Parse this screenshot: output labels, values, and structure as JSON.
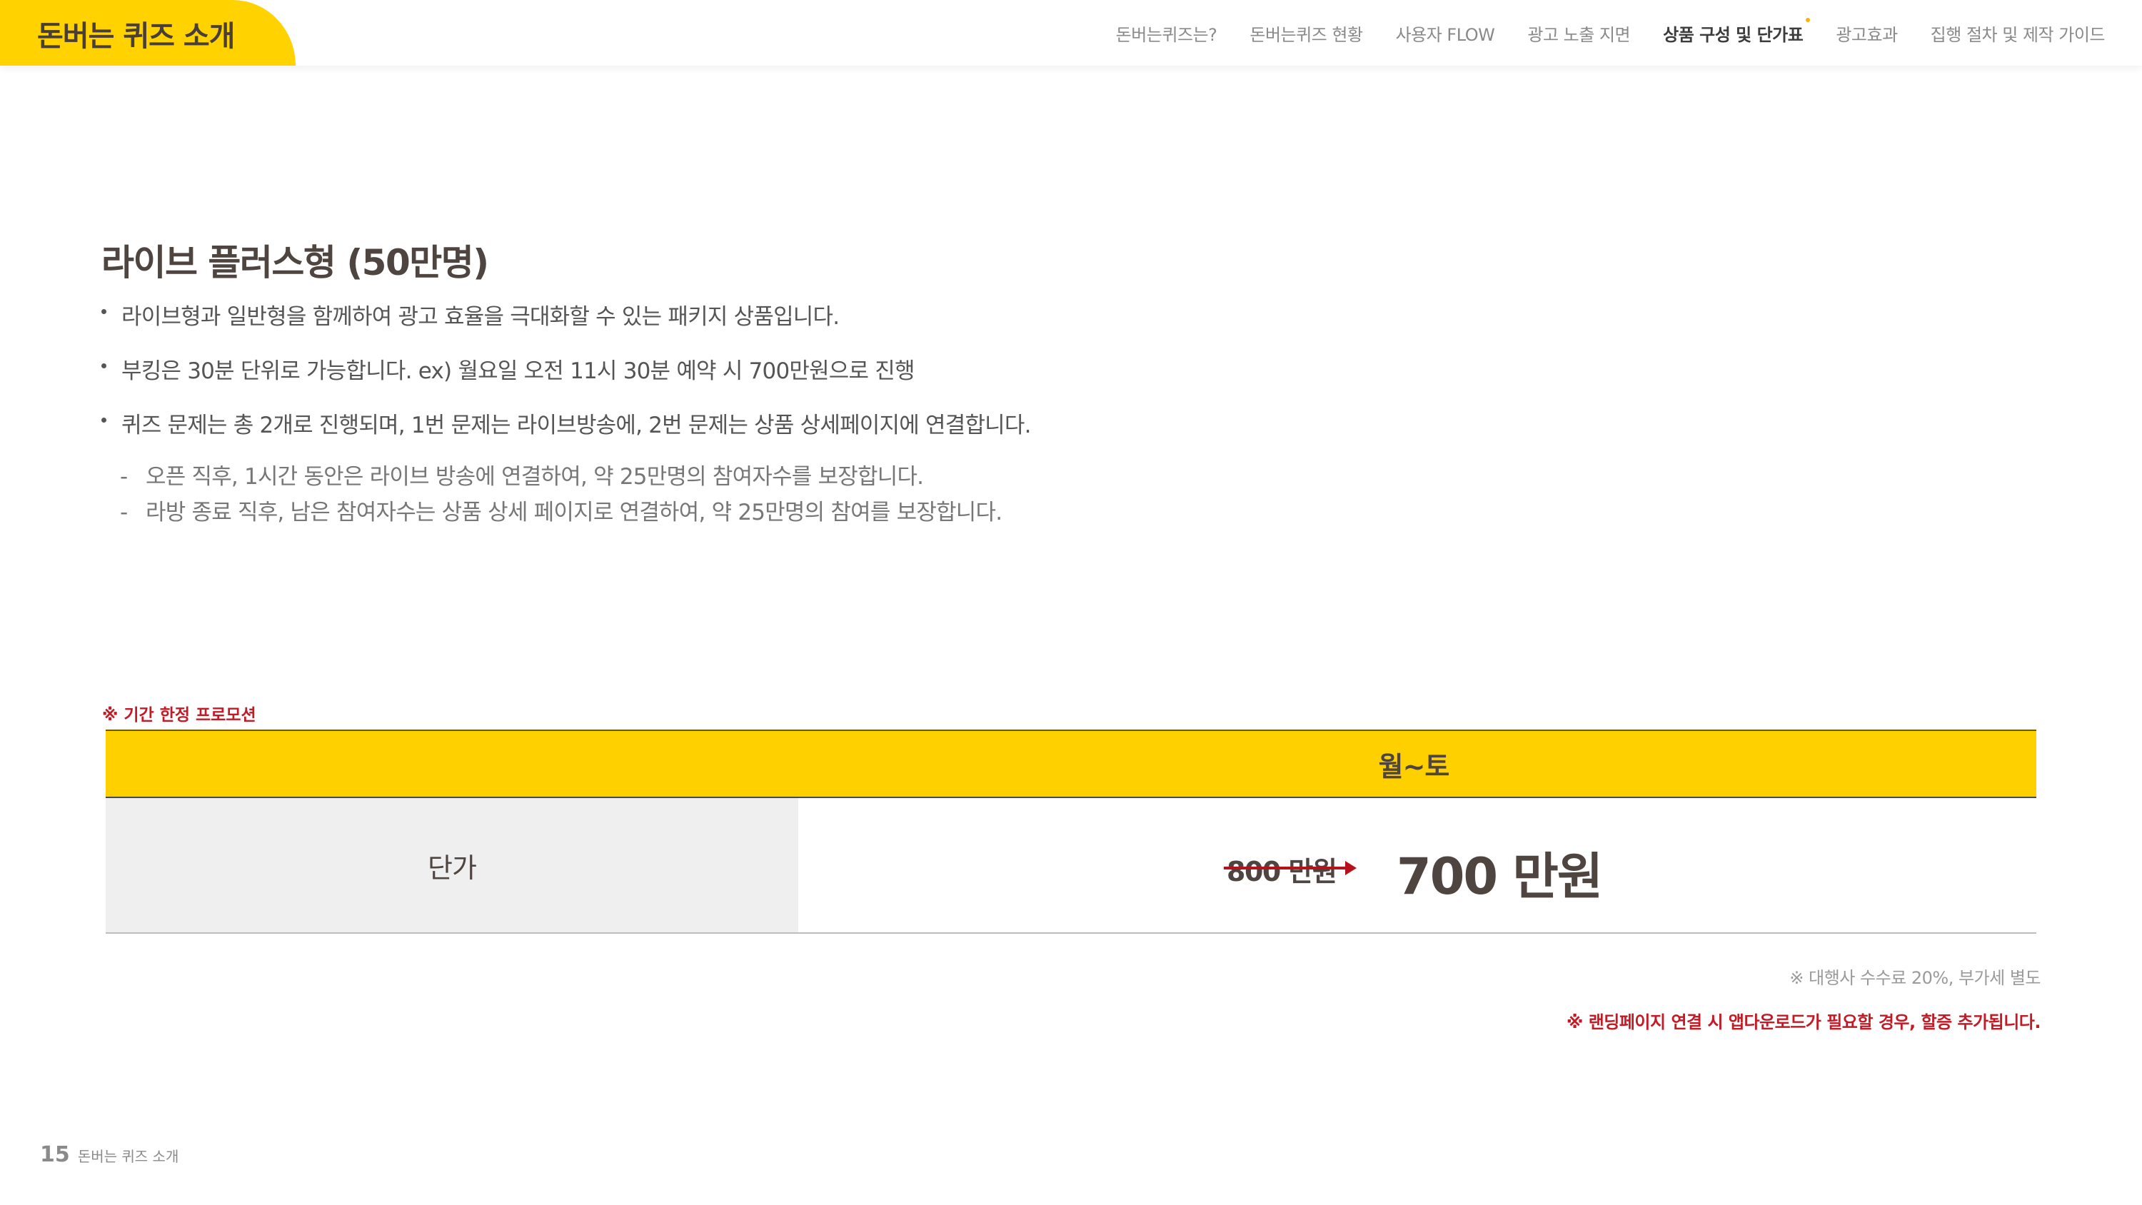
{
  "header": {
    "brand_title": "돈버는 퀴즈 소개",
    "nav": [
      {
        "label": "돈버는퀴즈는?",
        "active": false
      },
      {
        "label": "돈버는퀴즈 현황",
        "active": false
      },
      {
        "label": "사용자 FLOW",
        "active": false
      },
      {
        "label": "광고 노출 지면",
        "active": false
      },
      {
        "label": "상품 구성 및 단가표",
        "active": true
      },
      {
        "label": "광고효과",
        "active": false
      },
      {
        "label": "집행 절차 및 제작 가이드",
        "active": false
      }
    ]
  },
  "content": {
    "title": "라이브 플러스형 (50만명)",
    "bullets": [
      "라이브형과 일반형을 함께하여 광고 효율을 극대화할 수 있는 패키지 상품입니다.",
      "부킹은 30분 단위로 가능합니다. ex) 월요일 오전 11시 30분 예약 시 700만원으로 진행",
      "퀴즈 문제는 총 2개로 진행되며, 1번 문제는 라이브방송에, 2번 문제는 상품 상세페이지에 연결합니다."
    ],
    "sub_items": [
      "오픈 직후, 1시간 동안은 라이브 방송에 연결하여, 약 25만명의 참여자수를 보장합니다.",
      "라방 종료 직후, 남은 참여자수는 상품 상세 페이지로 연결하여, 약 25만명의 참여를 보장합니다."
    ],
    "sub_dash": "-"
  },
  "promo_note": "※ 기간 한정 프로모션",
  "table": {
    "header": "월~토",
    "row_label": "단가",
    "old_price": "800 만원",
    "new_price": "700 만원"
  },
  "notes": {
    "fee": "※ 대행사 수수료 20%, 부가세 별도",
    "landing": "※ 랜딩페이지 연결 시 앱다운로드가 필요할 경우, 할증 추가됩니다."
  },
  "footer": {
    "page_number": "15",
    "label": "돈버는 퀴즈 소개"
  },
  "colors": {
    "accent_yellow": "#ffd200",
    "promo_red": "#c41a25",
    "text_dark": "#4e4440"
  }
}
